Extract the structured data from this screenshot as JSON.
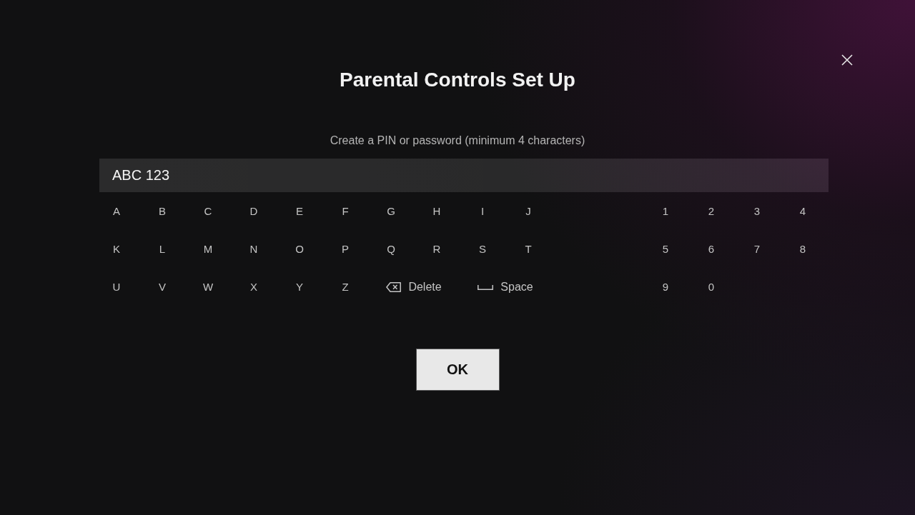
{
  "title": "Parental Controls Set Up",
  "prompt": "Create a PIN or password (minimum 4 characters)",
  "pin_field": {
    "value": "ABC 123"
  },
  "keyboard": {
    "letter_rows": [
      {
        "keys": [
          {
            "kind": "char",
            "label": "A"
          },
          {
            "kind": "char",
            "label": "B"
          },
          {
            "kind": "char",
            "label": "C"
          },
          {
            "kind": "char",
            "label": "D"
          },
          {
            "kind": "char",
            "label": "E"
          },
          {
            "kind": "char",
            "label": "F"
          },
          {
            "kind": "char",
            "label": "G"
          },
          {
            "kind": "char",
            "label": "H"
          },
          {
            "kind": "char",
            "label": "I"
          },
          {
            "kind": "char",
            "label": "J"
          }
        ]
      },
      {
        "keys": [
          {
            "kind": "char",
            "label": "K"
          },
          {
            "kind": "char",
            "label": "L"
          },
          {
            "kind": "char",
            "label": "M"
          },
          {
            "kind": "char",
            "label": "N"
          },
          {
            "kind": "char",
            "label": "O"
          },
          {
            "kind": "char",
            "label": "P"
          },
          {
            "kind": "char",
            "label": "Q"
          },
          {
            "kind": "char",
            "label": "R"
          },
          {
            "kind": "char",
            "label": "S"
          },
          {
            "kind": "char",
            "label": "T"
          }
        ]
      },
      {
        "keys": [
          {
            "kind": "char",
            "label": "U"
          },
          {
            "kind": "char",
            "label": "V"
          },
          {
            "kind": "char",
            "label": "W"
          },
          {
            "kind": "char",
            "label": "X"
          },
          {
            "kind": "char",
            "label": "Y"
          },
          {
            "kind": "char",
            "label": "Z"
          },
          {
            "kind": "delete",
            "label": "Delete"
          },
          {
            "kind": "space",
            "label": "Space"
          }
        ]
      }
    ],
    "number_rows": [
      {
        "keys": [
          {
            "kind": "char",
            "label": "1"
          },
          {
            "kind": "char",
            "label": "2"
          },
          {
            "kind": "char",
            "label": "3"
          },
          {
            "kind": "char",
            "label": "4"
          }
        ]
      },
      {
        "keys": [
          {
            "kind": "char",
            "label": "5"
          },
          {
            "kind": "char",
            "label": "6"
          },
          {
            "kind": "char",
            "label": "7"
          },
          {
            "kind": "char",
            "label": "8"
          }
        ]
      },
      {
        "keys": [
          {
            "kind": "char",
            "label": "9"
          },
          {
            "kind": "char",
            "label": "0"
          }
        ]
      }
    ]
  },
  "ok_button": {
    "label": "OK"
  }
}
